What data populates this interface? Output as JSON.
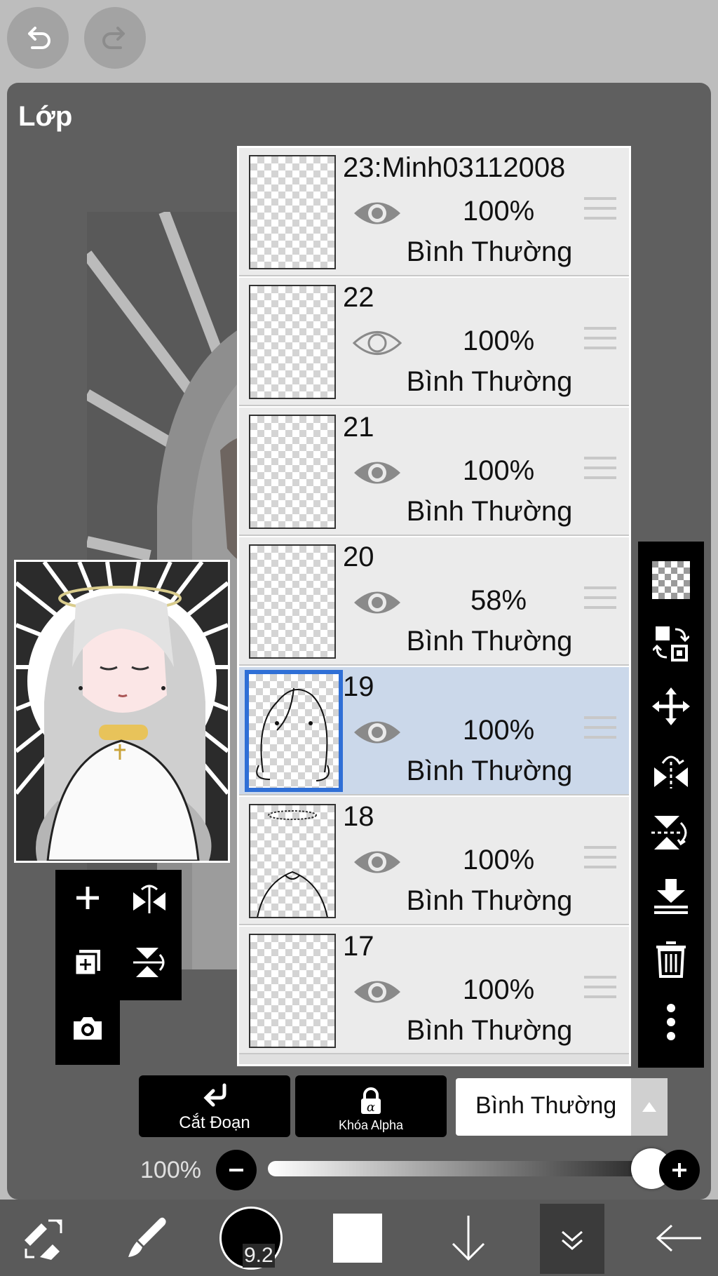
{
  "panel": {
    "title": "Lớp"
  },
  "layers": [
    {
      "name": "23:Minh03112008",
      "opacity": "100%",
      "blend": "Bình Thường",
      "visible": true,
      "selected": false
    },
    {
      "name": "22",
      "opacity": "100%",
      "blend": "Bình Thường",
      "visible": false,
      "selected": false
    },
    {
      "name": "21",
      "opacity": "100%",
      "blend": "Bình Thường",
      "visible": true,
      "selected": false
    },
    {
      "name": "20",
      "opacity": "58%",
      "blend": "Bình Thường",
      "visible": true,
      "selected": false
    },
    {
      "name": "19",
      "opacity": "100%",
      "blend": "Bình Thường",
      "visible": true,
      "selected": true
    },
    {
      "name": "18",
      "opacity": "100%",
      "blend": "Bình Thường",
      "visible": true,
      "selected": false
    },
    {
      "name": "17",
      "opacity": "100%",
      "blend": "Bình Thường",
      "visible": true,
      "selected": false
    }
  ],
  "actions": {
    "clip_label": "Cắt Đoạn",
    "alpha_lock_label": "Khóa Alpha",
    "blend_mode_value": "Bình Thường"
  },
  "opacity_control": {
    "label": "100%",
    "value": 1.0
  },
  "brush": {
    "size_label": "9.2"
  },
  "colors": {
    "selected_layer": "#cbd8ea",
    "selection_border": "#2f6fd6",
    "panel": "#5f5f5f"
  },
  "icons": {
    "top": [
      "undo-icon",
      "redo-icon"
    ],
    "side": [
      "transparency-icon",
      "swap-layer-icon",
      "move-icon",
      "flip-horizontal-icon",
      "flip-vertical-icon",
      "merge-down-icon",
      "trash-icon",
      "more-icon"
    ],
    "mini": [
      "add-layer-icon",
      "flip-h-icon",
      "add-layer-duplicate-icon",
      "flip-v-icon",
      "camera-icon"
    ],
    "bottom": [
      "transform-icon",
      "brush-icon",
      "brush-size-icon",
      "color-swatch-icon",
      "arrow-down-icon",
      "collapse-icon",
      "back-arrow-icon"
    ]
  }
}
